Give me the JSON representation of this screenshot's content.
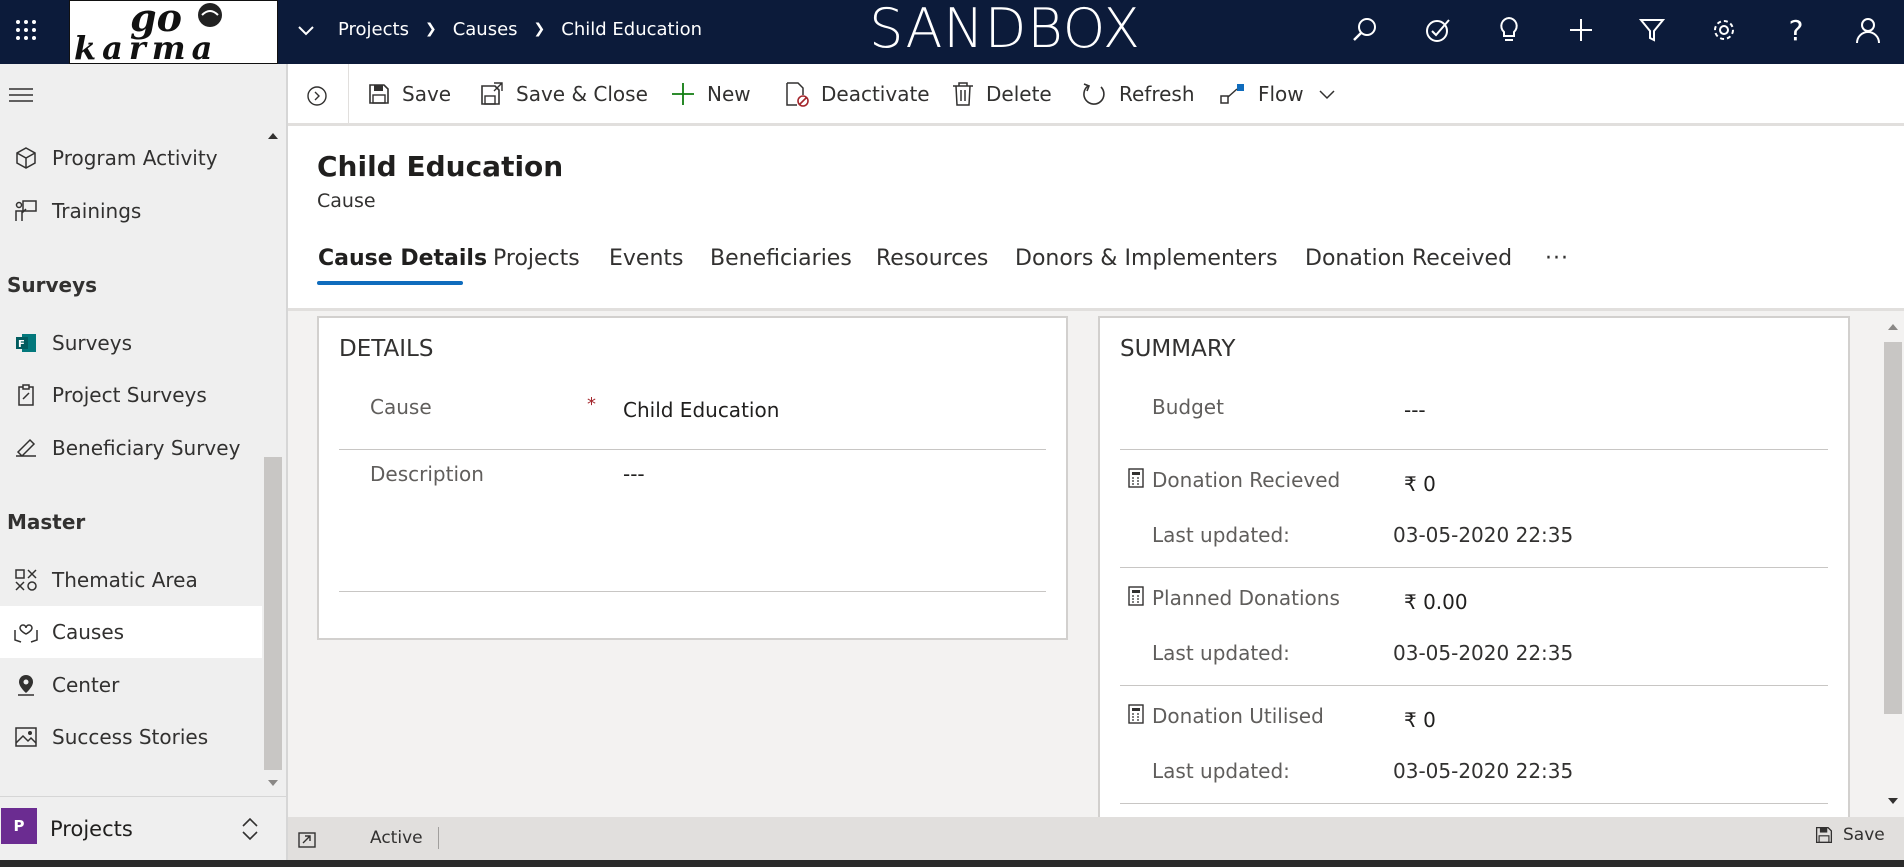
{
  "app": {
    "banner": "SANDBOX",
    "logo_text": "go karma"
  },
  "breadcrumb": {
    "items": [
      "Projects",
      "Causes",
      "Child Education"
    ]
  },
  "toolbar": {
    "save": "Save",
    "save_close": "Save & Close",
    "new": "New",
    "deactivate": "Deactivate",
    "delete": "Delete",
    "refresh": "Refresh",
    "flow": "Flow"
  },
  "sidebar": {
    "items_top": [
      "Program Activity",
      "Trainings"
    ],
    "surveys_header": "Surveys",
    "surveys": [
      "Surveys",
      "Project Surveys",
      "Beneficiary Survey"
    ],
    "master_header": "Master",
    "master": [
      "Thematic Area",
      "Causes",
      "Center",
      "Success Stories"
    ],
    "area_badge": "P",
    "area_label": "Projects"
  },
  "record": {
    "title": "Child Education",
    "entity": "Cause"
  },
  "tabs": [
    "Cause Details",
    "Projects",
    "Events",
    "Beneficiaries",
    "Resources",
    "Donors & Implementers",
    "Donation Received",
    "···"
  ],
  "details": {
    "header": "DETAILS",
    "cause_label": "Cause",
    "required_mark": "*",
    "cause_value": "Child Education",
    "description_label": "Description",
    "description_value": "---"
  },
  "summary": {
    "header": "SUMMARY",
    "budget_label": "Budget",
    "budget_value": "---",
    "rows": [
      {
        "label": "Donation Recieved",
        "value": "₹ 0",
        "updated_label": "Last updated:",
        "updated_value": "03-05-2020 22:35"
      },
      {
        "label": "Planned Donations",
        "value": "₹ 0.00",
        "updated_label": "Last updated:",
        "updated_value": "03-05-2020 22:35"
      },
      {
        "label": "Donation Utilised",
        "value": "₹ 0",
        "updated_label": "Last updated:",
        "updated_value": "03-05-2020 22:35"
      }
    ]
  },
  "status": {
    "state": "Active",
    "save": "Save"
  },
  "colors": {
    "topbar": "#0c1b3a",
    "accent": "#0f6cbd",
    "area_badge": "#6b2c91",
    "new_icon": "#107c10",
    "required": "#a4262c"
  }
}
